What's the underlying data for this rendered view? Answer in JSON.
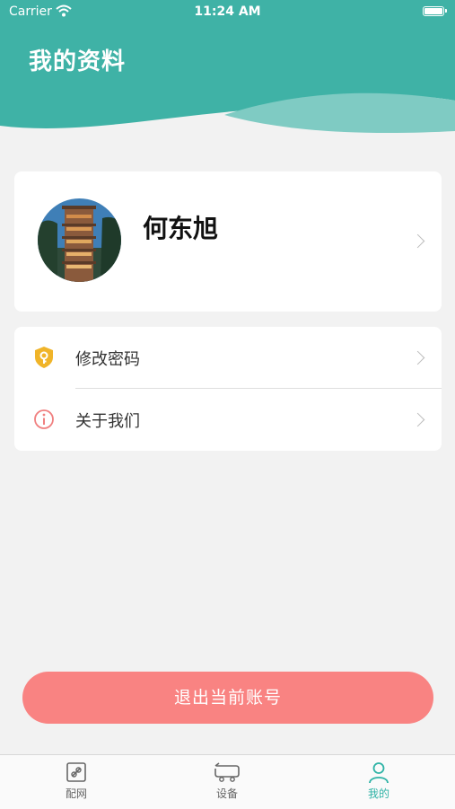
{
  "status_bar": {
    "carrier": "Carrier",
    "time": "11:24 AM"
  },
  "header": {
    "title": "我的资料"
  },
  "profile": {
    "name": "何东旭"
  },
  "menu": {
    "items": [
      {
        "label": "修改密码",
        "icon": "shield-key-icon"
      },
      {
        "label": "关于我们",
        "icon": "info-icon"
      }
    ]
  },
  "logout": {
    "label": "退出当前账号"
  },
  "tabbar": {
    "tabs": [
      {
        "label": "配网",
        "icon": "edit-link-icon"
      },
      {
        "label": "设备",
        "icon": "device-icon"
      },
      {
        "label": "我的",
        "icon": "user-icon",
        "active": true
      }
    ]
  },
  "colors": {
    "header": "#3fb2a6",
    "wave_light": "#7fcbc3",
    "logout": "#f98382",
    "active_tab": "#2fb3a6"
  }
}
